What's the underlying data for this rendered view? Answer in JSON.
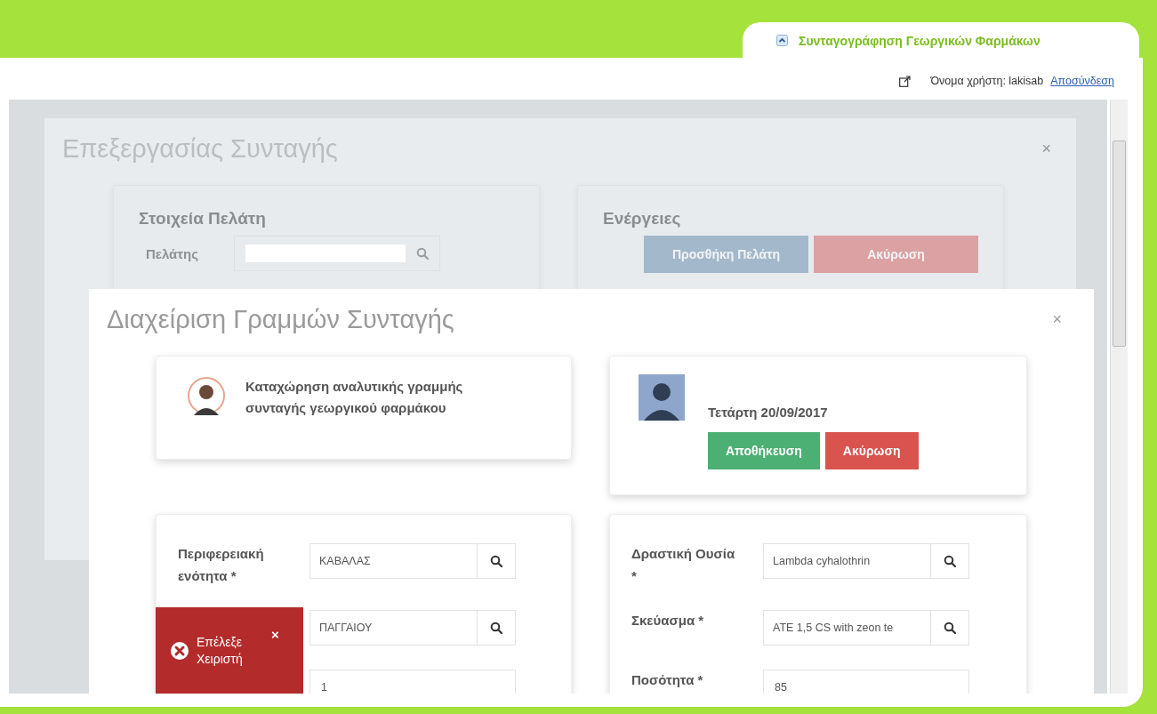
{
  "header": {
    "title": "Συνταγογράφηση Γεωργικών Φαρμάκων",
    "user_label": "Όνομα χρήστη: lakisab",
    "logout_link": "Αποσύνδεση"
  },
  "edit_dialog": {
    "title": "Επεξεργασίας Συνταγής",
    "close": "×",
    "customer_panel": {
      "title": "Στοιχεία Πελάτη",
      "field_label": "Πελάτης"
    },
    "actions_panel": {
      "title": "Ενέργειες",
      "buttons": [
        {
          "label": "Προσθήκη Πελάτη",
          "kind": "primary"
        },
        {
          "label": "Ακύρωση",
          "kind": "danger"
        }
      ]
    }
  },
  "lines_dialog": {
    "title": "Διαχείριση Γραμμών Συνταγής",
    "close": "×",
    "intro": "Καταχώρηση αναλυτικής γραμμής συνταγής γεωργικού φαρμάκου",
    "date": "Τετάρτη 20/09/2017",
    "buttons": [
      {
        "label": "Αποθήκευση",
        "kind": "success"
      },
      {
        "label": "Ακύρωση",
        "kind": "danger"
      }
    ],
    "form_left": [
      {
        "label": "Περιφερειακή ενότητα *",
        "value": "ΚΑΒΑΛΑΣ",
        "kind": "lookup"
      },
      {
        "value": "ΠΑΓΓΑΙΟΥ",
        "kind": "lookup"
      },
      {
        "value": "1",
        "kind": "text"
      }
    ],
    "form_right": [
      {
        "label": "Δραστική Ουσία *",
        "value": "Lambda cyhalothrin",
        "kind": "lookup"
      },
      {
        "label": "Σκεύασμα *",
        "value": "ATE 1,5 CS with zeon te",
        "kind": "lookup"
      },
      {
        "label": "Ποσότητα *",
        "value": "85",
        "kind": "text"
      }
    ]
  },
  "toast": {
    "message": "Επέλεξε Χειριστή",
    "close": "×"
  }
}
